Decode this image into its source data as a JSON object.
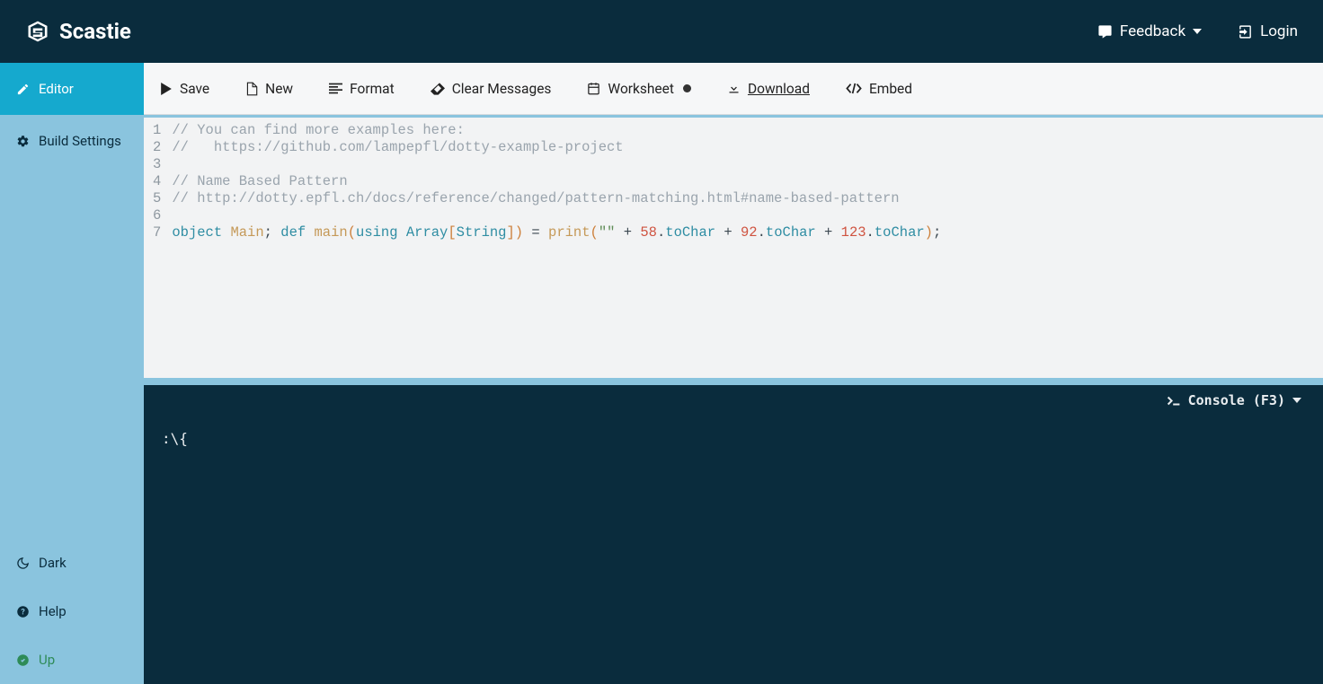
{
  "header": {
    "app_name": "Scastie",
    "feedback_label": "Feedback",
    "login_label": "Login"
  },
  "sidebar": {
    "editor_label": "Editor",
    "build_settings_label": "Build Settings",
    "dark_label": "Dark",
    "help_label": "Help",
    "up_label": "Up"
  },
  "toolbar": {
    "save_label": "Save",
    "new_label": "New",
    "format_label": "Format",
    "clear_label": "Clear Messages",
    "worksheet_label": "Worksheet",
    "download_label": "Download",
    "embed_label": "Embed"
  },
  "editor": {
    "line_numbers": [
      "1",
      "2",
      "3",
      "4",
      "5",
      "6",
      "7"
    ],
    "lines": {
      "c1": "// You can find more examples here:",
      "c2": "//   https://github.com/lampepfl/dotty-example-project",
      "c3": "",
      "c4": "// Name Based Pattern",
      "c5": "// http://dotty.epfl.ch/docs/reference/changed/pattern-matching.html#name-based-pattern",
      "c6": "",
      "kw_object": "object",
      "name_main": "Main",
      "semi1": "; ",
      "kw_def": "def",
      "fn_main": "main",
      "paren_open": "(",
      "kw_using": "using",
      "sp": " ",
      "type_array": "Array",
      "bracket_open": "[",
      "type_string": "String",
      "bracket_close": "]",
      "paren_close": ")",
      "eq": " = ",
      "fn_print": "print",
      "paren_open2": "(",
      "str_empty": "\"\"",
      "plus": " + ",
      "num1": "58",
      "dot": ".",
      "m_tochar": "toChar",
      "num2": "92",
      "num3": "123",
      "paren_close2": ")",
      "semi2": ";"
    }
  },
  "console": {
    "header_label": "Console (F3)",
    "output": ":\\{"
  }
}
